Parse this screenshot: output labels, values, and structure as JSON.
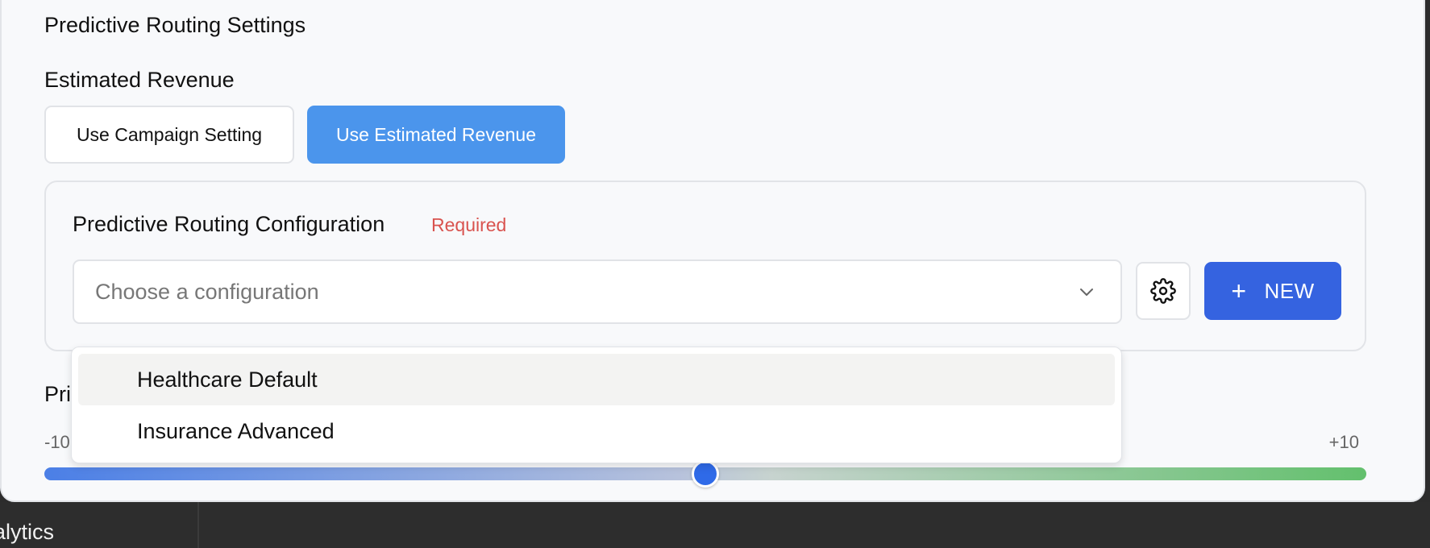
{
  "settings": {
    "title": "Predictive Routing Settings",
    "revenue_title": "Estimated Revenue",
    "revenue_options": [
      "Use Campaign Setting",
      "Use Estimated Revenue"
    ],
    "selected_revenue_option": "Use Estimated Revenue"
  },
  "config": {
    "label": "Predictive Routing Configuration",
    "required_text": "Required",
    "placeholder": "Choose a configuration",
    "new_button_label": "NEW",
    "options": [
      "Healthcare Default",
      "Insurance Advanced"
    ],
    "highlighted_option": "Healthcare Default"
  },
  "priority": {
    "label": "Pri",
    "min_label": "-10",
    "max_label": "+10",
    "range": [
      -10,
      10
    ],
    "value": 0
  },
  "bottom": {
    "label": "alytics"
  },
  "colors": {
    "accent": "#3563e0",
    "selected_segment": "#4b95ec",
    "required": "#d9534f",
    "slider_start": "#4b7fe6",
    "slider_end": "#63c06d"
  },
  "icons": {
    "dropdown": "chevron-down-icon",
    "settings": "gear-icon",
    "new": "plus-icon"
  }
}
